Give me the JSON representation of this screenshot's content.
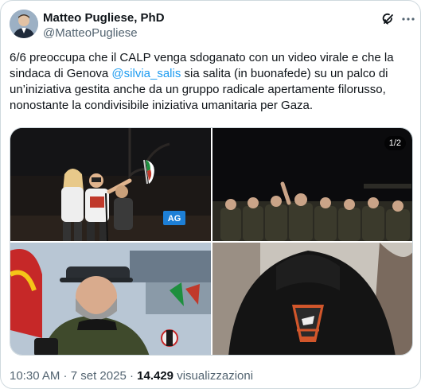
{
  "author": {
    "display_name": "Matteo Pugliese, PhD",
    "handle": "@MatteoPugliese"
  },
  "tweet": {
    "text_1": "6/6 preoccupa che il CALP venga sdoganato con un video virale e che la sindaca di Genova ",
    "mention": "@silvia_salis",
    "text_2": " sia salita (in buonafede) su un palco di un’iniziativa gestita anche da un gruppo radicale apertamente filorusso, nonostante la condivisibile iniziativa umanitaria per Gaza."
  },
  "media": {
    "counter": "1/2",
    "logo_text": "AG"
  },
  "meta": {
    "time": "10:30 AM",
    "separator": " · ",
    "date": "7 set 2025",
    "views_count": "14.429",
    "views_label": " visualizzazioni"
  },
  "icons": {
    "grok": "grok-icon",
    "more": "more-icon"
  },
  "colors": {
    "link": "#1d9bf0",
    "secondary_text": "#536471",
    "border": "#cfd9de"
  }
}
